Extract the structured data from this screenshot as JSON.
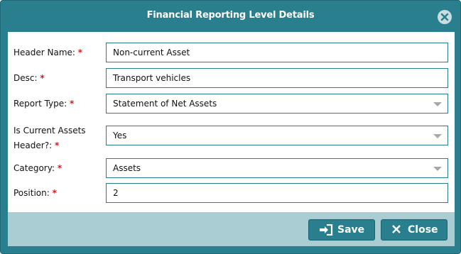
{
  "dialog": {
    "title": "Financial Reporting Level Details"
  },
  "form": {
    "header_name": {
      "label": "Header Name:",
      "required_mark": "*",
      "value": "Non-current Asset"
    },
    "desc": {
      "label": "Desc:",
      "required_mark": "*",
      "value": "Transport vehicles"
    },
    "report_type": {
      "label": "Report Type:",
      "required_mark": "*",
      "value": "Statement of Net Assets"
    },
    "is_current_assets_header": {
      "label_line1": "Is Current Assets",
      "label_line2": "Header?:",
      "required_mark": "*",
      "value": "Yes"
    },
    "category": {
      "label": "Category:",
      "required_mark": "*",
      "value": "Assets"
    },
    "position": {
      "label": "Position:",
      "required_mark": "*",
      "value": "2"
    }
  },
  "footer": {
    "save_label": "Save",
    "close_label": "Close"
  },
  "icons": {
    "close_dialog": "close-circle-icon",
    "save": "sign-in-icon",
    "close": "x-icon",
    "dropdown": "chevron-down-icon"
  },
  "colors": {
    "frame": "#2a7f8e",
    "footer": "#a9cdd3",
    "required": "#d11b1b"
  }
}
